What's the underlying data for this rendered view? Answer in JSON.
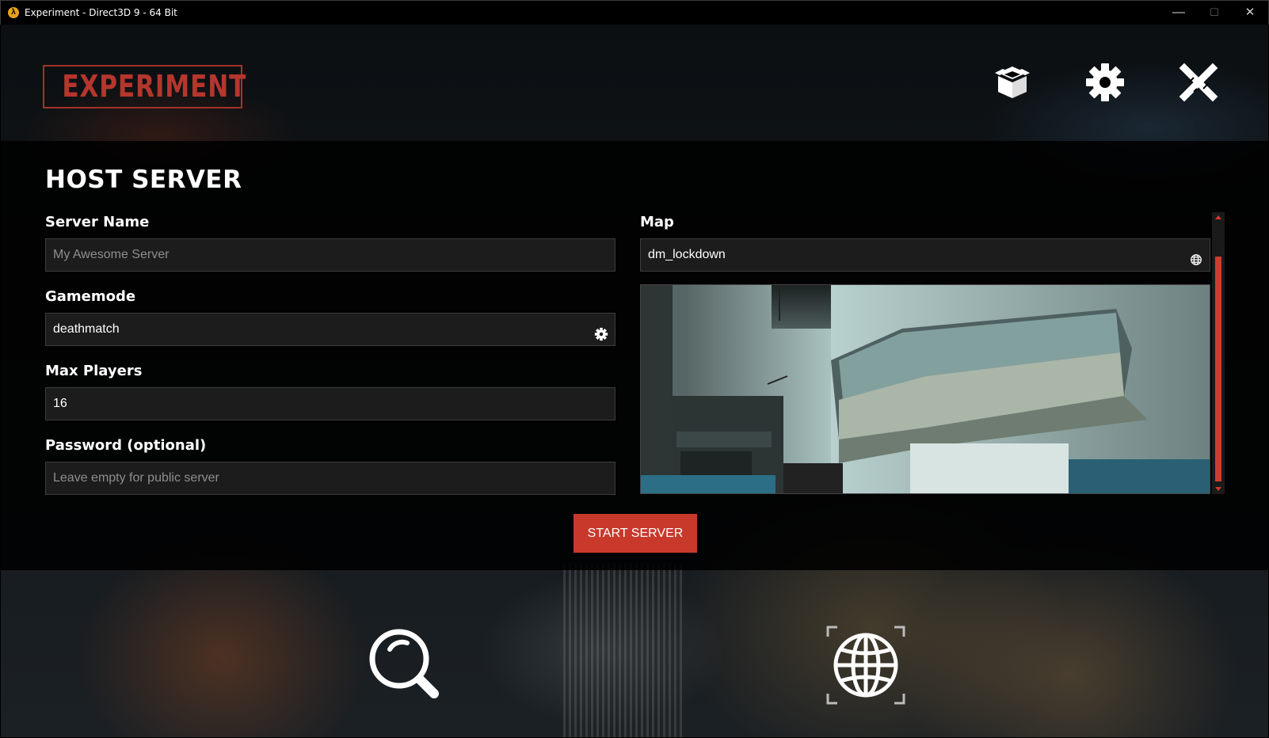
{
  "window": {
    "title": "Experiment - Direct3D 9 - 64 Bit",
    "app_icon": "half-life-lambda-icon",
    "minimize_glyph": "—",
    "maximize_glyph": "☐",
    "close_glyph": "✕"
  },
  "header": {
    "logo_text": "EXPERIMENT",
    "icons": [
      "package-icon",
      "settings-gear-icon",
      "disconnect-x-icon"
    ]
  },
  "page": {
    "title": "HOST SERVER"
  },
  "form": {
    "server_name": {
      "label": "Server Name",
      "value": "",
      "placeholder": "My Awesome Server"
    },
    "gamemode": {
      "label": "Gamemode",
      "value": "deathmatch",
      "icon": "gear-icon"
    },
    "max_players": {
      "label": "Max Players",
      "value": "16"
    },
    "password": {
      "label": "Password (optional)",
      "value": "",
      "placeholder": "Leave empty for public server"
    },
    "map": {
      "label": "Map",
      "value": "dm_lockdown",
      "icon": "globe-icon"
    },
    "submit_label": "START SERVER"
  },
  "bottom_nav": {
    "icons": [
      "server-browser-search-icon",
      "host-server-globe-icon"
    ]
  },
  "colors": {
    "accent": "#c8392c",
    "logo": "#b5362c",
    "field_bg": "#1c1c1c",
    "panel_bg": "#000000"
  }
}
